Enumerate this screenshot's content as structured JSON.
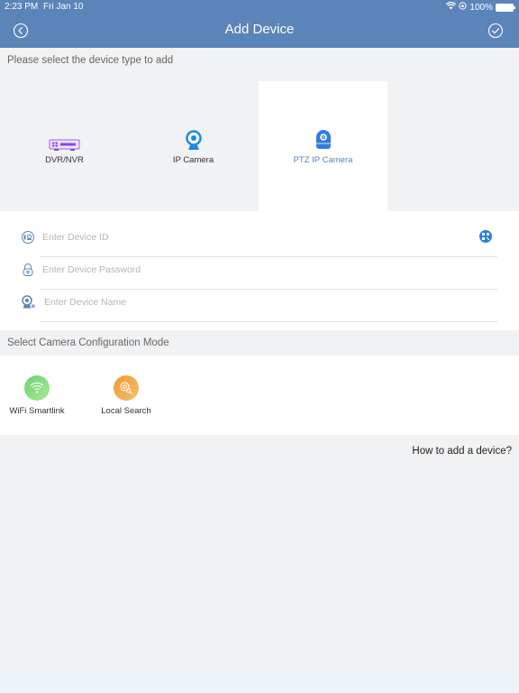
{
  "status_bar": {
    "time": "2:23 PM",
    "date": "Fri Jan 10",
    "battery": "100%",
    "icons": [
      "wifi-icon",
      "orientation-lock-icon",
      "battery-icon"
    ]
  },
  "header": {
    "title": "Add Device",
    "back_icon": "back-circle-icon",
    "done_icon": "check-circle-icon",
    "color": "#5b84b8"
  },
  "device_type": {
    "prompt": "Please select the device type to add",
    "selected": "PTZ IP Camera",
    "options": [
      {
        "label": "DVR/NVR",
        "icon": "dvr-icon"
      },
      {
        "label": "IP Camera",
        "icon": "ip-camera-icon"
      },
      {
        "label": "PTZ IP Camera",
        "icon": "ptz-camera-icon"
      }
    ]
  },
  "form": {
    "device_id": {
      "value": "",
      "placeholder": "Enter Device ID",
      "icon": "device-id-icon",
      "action_icon": "qr-scan-icon"
    },
    "password": {
      "value": "",
      "placeholder": "Enter Device Password",
      "icon": "lock-icon"
    },
    "name": {
      "value": "",
      "placeholder": "Enter Device Name",
      "icon": "camera-name-icon"
    }
  },
  "config_mode": {
    "prompt": "Select Camera Configuration Mode",
    "options": [
      {
        "label": "WiFi Smartlink",
        "icon": "wifi-icon",
        "color": "#7dd87a"
      },
      {
        "label": "Local Search",
        "icon": "local-search-icon",
        "color": "#f0a03c"
      }
    ]
  },
  "help_link": "How to add a device?",
  "colors": {
    "accent": "#5b84b8",
    "selected_text": "#5b84b8",
    "qr_button": "#2f7de1",
    "background": "#f1f2f4"
  }
}
